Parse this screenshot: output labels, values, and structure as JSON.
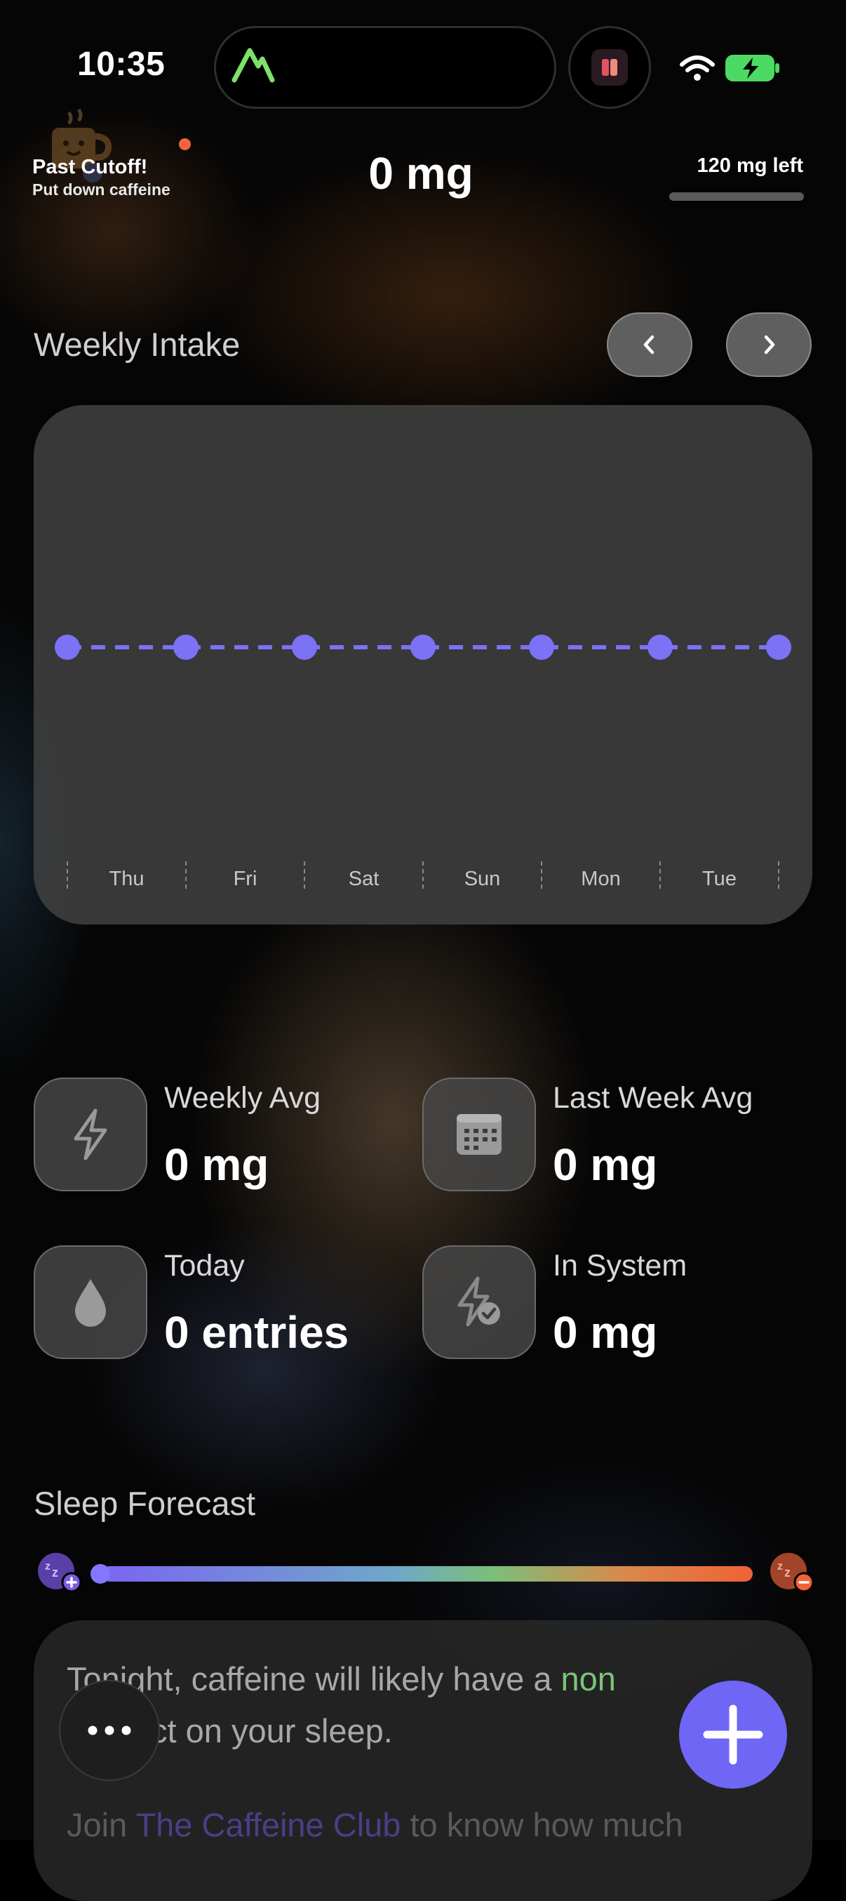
{
  "status_bar": {
    "time": "10:35"
  },
  "header": {
    "cutoff_title": "Past Cutoff!",
    "cutoff_subtitle": "Put down caffeine",
    "total_today": "0 mg",
    "remaining": "120 mg left"
  },
  "weekly": {
    "title": "Weekly Intake",
    "prev_icon": "chevron-left-icon",
    "next_icon": "chevron-right-icon"
  },
  "chart_data": {
    "type": "line",
    "title": "",
    "categories": [
      "Thu",
      "Fri",
      "Sat",
      "Sun",
      "Mon",
      "Tue"
    ],
    "series": [
      {
        "values": [
          0,
          0,
          0,
          0,
          0,
          0,
          0
        ]
      }
    ],
    "line_style": "dashed",
    "color": "#7b72f5",
    "grid": false
  },
  "stats": [
    {
      "icon": "bolt-icon",
      "label": "Weekly Avg",
      "value": "0 mg"
    },
    {
      "icon": "calendar-icon",
      "label": "Last Week Avg",
      "value": "0 mg"
    },
    {
      "icon": "drop-icon",
      "label": "Today",
      "value": "0 entries"
    },
    {
      "icon": "bolt-check-icon",
      "label": "In System",
      "value": "0 mg"
    }
  ],
  "sleep": {
    "title": "Sleep Forecast",
    "forecast_prefix": "Tonight, caffeine will likely have a ",
    "forecast_highlight": "non",
    "forecast_suffix": " ",
    "forecast_line2": "ct on your sleep.",
    "join_prefix": "Join ",
    "join_link": "The Caffeine Club",
    "join_suffix": " to know how much",
    "level": 0
  },
  "actions": {
    "more_icon": "ellipsis-icon",
    "add_icon": "plus-icon"
  },
  "colors": {
    "accent": "#6f66f6",
    "warning": "#f0663a",
    "positive": "#7bc47a"
  }
}
